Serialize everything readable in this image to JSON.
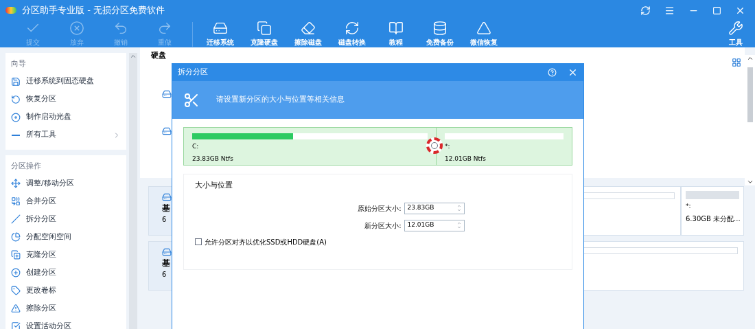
{
  "window": {
    "title": "分区助手专业版 - 无损分区免费软件"
  },
  "toolbar": [
    {
      "label": "提交",
      "disabled": true
    },
    {
      "label": "放弃",
      "disabled": true
    },
    {
      "label": "撤销",
      "disabled": true
    },
    {
      "label": "重做",
      "disabled": true
    },
    {
      "label": "迁移系统",
      "disabled": false
    },
    {
      "label": "克隆硬盘",
      "disabled": false
    },
    {
      "label": "擦除磁盘",
      "disabled": false
    },
    {
      "label": "磁盘转换",
      "disabled": false
    },
    {
      "label": "教程",
      "disabled": false
    },
    {
      "label": "免费备份",
      "disabled": false
    },
    {
      "label": "微信恢复",
      "disabled": false
    }
  ],
  "tools_button": {
    "label": "工具"
  },
  "sidebar": [
    {
      "title": "向导",
      "items": [
        {
          "label": "迁移系统到固态硬盘",
          "kind": "action"
        },
        {
          "label": "恢复分区",
          "kind": "action"
        },
        {
          "label": "制作启动光盘",
          "kind": "action"
        },
        {
          "label": "所有工具",
          "kind": "submenu"
        }
      ]
    },
    {
      "title": "分区操作",
      "items": [
        {
          "label": "调整/移动分区",
          "kind": "action"
        },
        {
          "label": "合并分区",
          "kind": "action"
        },
        {
          "label": "拆分分区",
          "kind": "action"
        },
        {
          "label": "分配空闲空间",
          "kind": "action"
        },
        {
          "label": "克隆分区",
          "kind": "action"
        },
        {
          "label": "创建分区",
          "kind": "action"
        },
        {
          "label": "更改卷标",
          "kind": "action"
        },
        {
          "label": "擦除分区",
          "kind": "action"
        },
        {
          "label": "设置活动分区",
          "kind": "action"
        }
      ]
    }
  ],
  "main": {
    "header": "硬盘",
    "disk_cards": [
      {
        "line_1": "基",
        "line_2": "6"
      },
      {
        "line_1": "基",
        "line_2": "6"
      }
    ],
    "unallocated": {
      "letter": "*:",
      "info": "6.30GB 未分配..."
    }
  },
  "dialog": {
    "title": "拆分分区",
    "banner": "请设置新分区的大小与位置等相关信息",
    "partitions": [
      {
        "letter": "C:",
        "info": "23.83GB Ntfs",
        "level": 0.43
      },
      {
        "letter": "*:",
        "info": "12.01GB Ntfs"
      }
    ],
    "section": "大小与位置",
    "fields": [
      {
        "label": "原始分区大小:",
        "value": "23.83GB"
      },
      {
        "label": "新分区大小:",
        "value": "12.01GB"
      }
    ],
    "align_option": {
      "label": "允许分区对齐以优化SSD或HDD硬盘(A)",
      "checked": false
    }
  }
}
